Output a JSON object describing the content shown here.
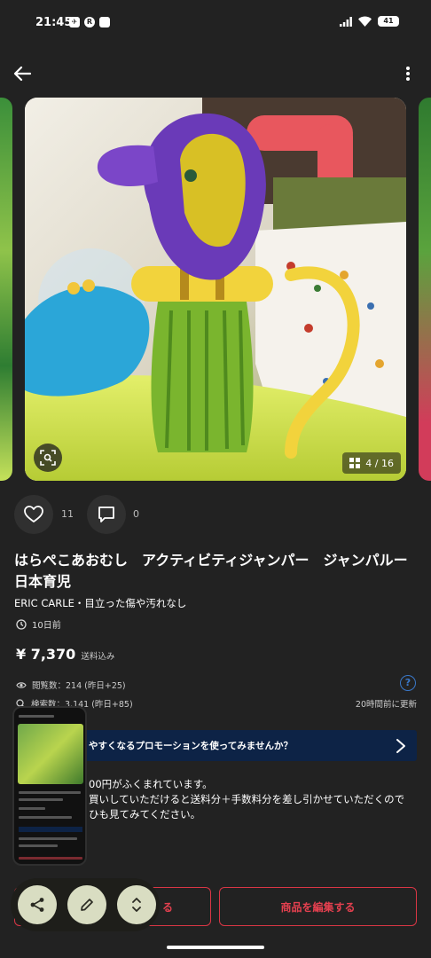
{
  "status_bar": {
    "time": "21:45",
    "left_icons": [
      "notification-app-icon",
      "r-app-icon",
      "square-app-icon"
    ],
    "battery": "41"
  },
  "app_bar": {
    "back_icon": "arrow-left-icon",
    "more_icon": "more-vertical-icon"
  },
  "gallery": {
    "counter": "4 / 16",
    "lens_icon": "image-search-icon"
  },
  "actions": {
    "likes": "11",
    "comments": "0"
  },
  "item": {
    "title": "はらぺこあおむし　アクティビティジャンパー　ジャンパルー　日本育児",
    "brand_condition": "ERIC CARLE・目立った傷や汚れなし",
    "posted": "10日前",
    "price": "¥ 7,370",
    "price_note": "送料込み",
    "views": "閲覧数：214 (昨日+25)",
    "searches": "検索数：3,141 (昨日+85)",
    "updated": "20時間前に更新"
  },
  "promo": {
    "banner": "やすくなるプロモーションを使ってみませんか？",
    "body_line1": "00円がふくまれています。",
    "body_line2": "買いしていただけると送料分＋手数料分を差し引かせていただくので",
    "body_line3": "ひも見てみてください。"
  },
  "buttons": {
    "left_partial": "る",
    "edit": "商品を編集する"
  },
  "floating_tools": [
    "share-icon",
    "pencil-icon",
    "expand-icon"
  ],
  "colors": {
    "background": "#222222",
    "accent_red": "#e4404f",
    "promo_navy": "#0d2346",
    "link_blue": "#3a78c9"
  }
}
